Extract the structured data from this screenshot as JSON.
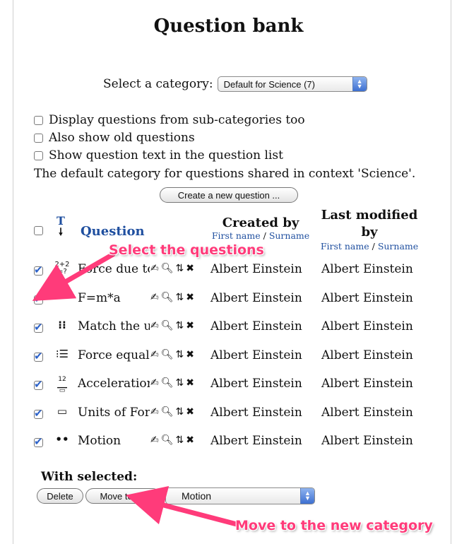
{
  "page": {
    "title": "Question bank"
  },
  "category": {
    "label": "Select a category:",
    "selected": "Default for Science (7)"
  },
  "options": [
    {
      "label": "Display questions from sub-categories too",
      "checked": false
    },
    {
      "label": "Also show old questions",
      "checked": false
    },
    {
      "label": "Show question text in the question list",
      "checked": false
    }
  ],
  "note": "The default category for questions shared in context 'Science'.",
  "create_button": "Create a new question ...",
  "table": {
    "type_header": "T",
    "type_sort_icon": "arrow-down",
    "question_header": "Question",
    "created_header": "Created by",
    "created_sub_first": "First name",
    "created_sub_sep": " / ",
    "created_sub_last": "Surname",
    "modified_header_1": "Last modified",
    "modified_header_2": "by",
    "modified_sub_first": "First name",
    "modified_sub_sep": " / ",
    "modified_sub_last": "Surname",
    "rows": [
      {
        "icon": "calculated-icon",
        "glyph": "²⁺²₌?",
        "name": "Force due to",
        "created": "Albert Einstein",
        "modified": "Albert Einstein",
        "checked": true
      },
      {
        "icon": "numerical-icon",
        "glyph": "",
        "name": "F=m*a",
        "created": "Albert Einstein",
        "modified": "Albert Einstein",
        "checked": true
      },
      {
        "icon": "matching-icon",
        "glyph": "⋮⋮",
        "name": "Match the ur",
        "created": "Albert Einstein",
        "modified": "Albert Einstein",
        "checked": true
      },
      {
        "icon": "multichoice-icon",
        "glyph": "⋮☰",
        "name": "Force equals",
        "created": "Albert Einstein",
        "modified": "Albert Einstein",
        "checked": true
      },
      {
        "icon": "shortanswer-icon",
        "glyph": "≗",
        "name": "Acceleration",
        "created": "Albert Einstein",
        "modified": "Albert Einstein",
        "checked": true
      },
      {
        "icon": "essay-icon",
        "glyph": "▭",
        "name": "Units of Forc",
        "created": "Albert Einstein",
        "modified": "Albert Einstein",
        "checked": true
      },
      {
        "icon": "truefalse-icon",
        "glyph": "••",
        "name": "Motion",
        "created": "Albert Einstein",
        "modified": "Albert Einstein",
        "checked": true
      }
    ],
    "action_icons": [
      "edit-icon",
      "preview-icon",
      "move-icon",
      "delete-icon"
    ]
  },
  "with_selected": {
    "label": "With selected:",
    "delete": "Delete",
    "move": "Move to >>",
    "target": "Motion"
  },
  "callouts": {
    "select": "Select the questions",
    "move": "Move to the new category"
  },
  "colors": {
    "link": "#1f4f9f",
    "callout": "#ff3b7a",
    "checkbox": "#2d62c8"
  }
}
